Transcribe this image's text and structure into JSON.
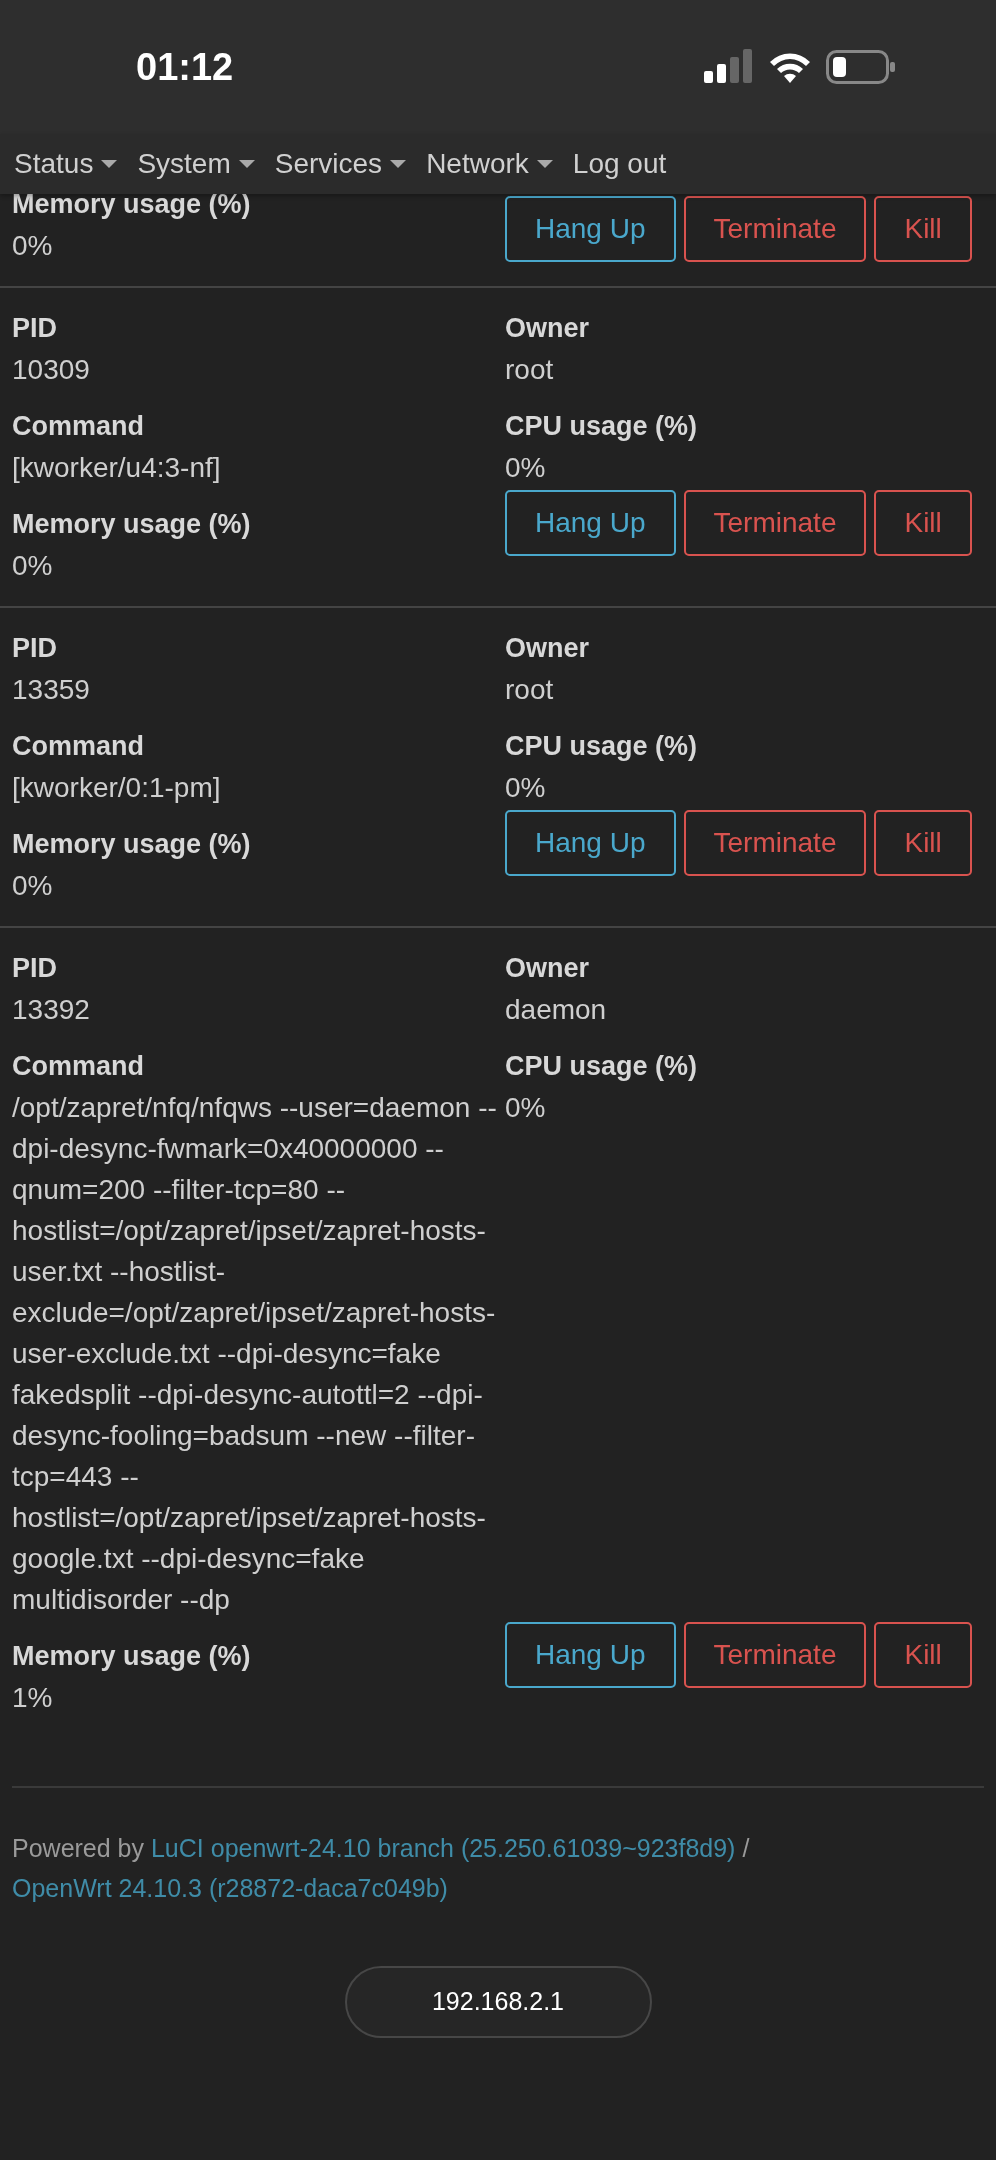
{
  "status_bar": {
    "time": "01:12"
  },
  "nav": {
    "items": [
      {
        "label": "Status",
        "dropdown": true
      },
      {
        "label": "System",
        "dropdown": true
      },
      {
        "label": "Services",
        "dropdown": true
      },
      {
        "label": "Network",
        "dropdown": true
      },
      {
        "label": "Log out",
        "dropdown": false
      }
    ]
  },
  "processes": [
    {
      "fields": [
        {
          "label": "Memory usage (%)",
          "value": "0%"
        }
      ],
      "actions": [
        {
          "label": "Hang Up",
          "kind": "info"
        },
        {
          "label": "Terminate",
          "kind": "danger"
        },
        {
          "label": "Kill",
          "kind": "danger"
        }
      ]
    },
    {
      "fields": [
        {
          "label": "PID",
          "value": "10309"
        },
        {
          "label": "Owner",
          "value": "root"
        },
        {
          "label": "Command",
          "value": "[kworker/u4:3-nf]"
        },
        {
          "label": "CPU usage (%)",
          "value": "0%"
        },
        {
          "label": "Memory usage (%)",
          "value": "0%"
        }
      ],
      "actions": [
        {
          "label": "Hang Up",
          "kind": "info"
        },
        {
          "label": "Terminate",
          "kind": "danger"
        },
        {
          "label": "Kill",
          "kind": "danger"
        }
      ]
    },
    {
      "fields": [
        {
          "label": "PID",
          "value": "13359"
        },
        {
          "label": "Owner",
          "value": "root"
        },
        {
          "label": "Command",
          "value": "[kworker/0:1-pm]"
        },
        {
          "label": "CPU usage (%)",
          "value": "0%"
        },
        {
          "label": "Memory usage (%)",
          "value": "0%"
        }
      ],
      "actions": [
        {
          "label": "Hang Up",
          "kind": "info"
        },
        {
          "label": "Terminate",
          "kind": "danger"
        },
        {
          "label": "Kill",
          "kind": "danger"
        }
      ]
    },
    {
      "fields": [
        {
          "label": "PID",
          "value": "13392"
        },
        {
          "label": "Owner",
          "value": "daemon"
        },
        {
          "label": "Command",
          "value": "/opt/zapret/nfq/nfqws --user=daemon --dpi-desync-fwmark=0x40000000 --qnum=200 --filter-tcp=80 --hostlist=/opt/zapret/ipset/zapret-hosts-user.txt --hostlist-exclude=/opt/zapret/ipset/zapret-hosts-user-exclude.txt --dpi-desync=fake fakedsplit --dpi-desync-autottl=2 --dpi-desync-fooling=badsum --new --filter-tcp=443 --hostlist=/opt/zapret/ipset/zapret-hosts-google.txt --dpi-desync=fake multidisorder --dp"
        },
        {
          "label": "CPU usage (%)",
          "value": "0%"
        },
        {
          "label": "Memory usage (%)",
          "value": "1%"
        }
      ],
      "actions": [
        {
          "label": "Hang Up",
          "kind": "info"
        },
        {
          "label": "Terminate",
          "kind": "danger"
        },
        {
          "label": "Kill",
          "kind": "danger"
        }
      ]
    }
  ],
  "footer": {
    "prefix": "Powered by",
    "links": [
      "LuCI openwrt-24.10 branch (25.250.61039~923f8d9)",
      "OpenWrt 24.10.3 (r28872-daca7c049b)"
    ],
    "separator": "/"
  },
  "url_bar": {
    "address": "192.168.2.1"
  }
}
